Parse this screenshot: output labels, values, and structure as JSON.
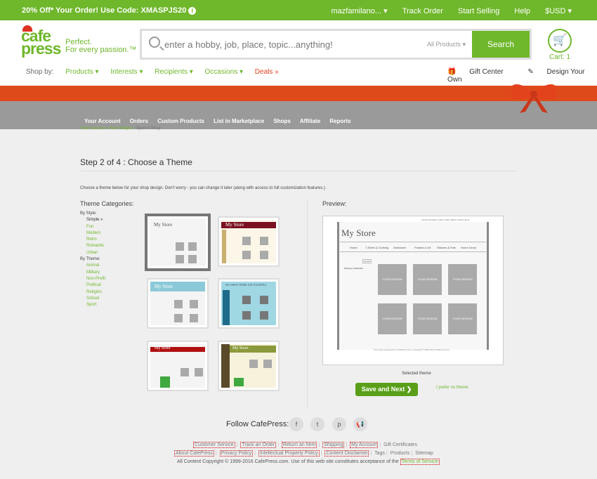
{
  "promo": {
    "text": "20% Off* Your Order! Use Code: XMASPJS20",
    "info_icon": "info-icon",
    "user": "mazfamilano... ▾",
    "track": "Track Order",
    "sell": "Start Selling",
    "help": "Help",
    "currency": "$USD ▾"
  },
  "header": {
    "logo_line1": "cafe",
    "logo_line2": "press",
    "tagline1": "Perfect.",
    "tagline2": "For every passion.™",
    "search_placeholder": "enter a hobby, job, place, topic...anything!",
    "search_category": "All Products ▾",
    "search_button": "Search",
    "cart_label": "Cart: 1"
  },
  "nav": {
    "shop_by": "Shop by:",
    "items": [
      "Products ▾",
      "Interests ▾",
      "Recipients ▾",
      "Occasions ▾"
    ],
    "deals": "Deals »",
    "gift_center": "Gift Center",
    "design": "Design Your Own"
  },
  "subnav": {
    "items": [
      "Your Account",
      "Orders",
      "Custom Products",
      "List in Marketplace",
      "Shops",
      "Affiliate",
      "Reports"
    ]
  },
  "breadcrumb": {
    "a": "Your Account",
    "b": "Your Shops",
    "c": "Open A Shop"
  },
  "step": {
    "title": "Step 2 of 4 : Choose a Theme",
    "description": "Choose a theme below for your shop design. Don't worry - you can change it later (along with access to full customization features.)"
  },
  "categories": {
    "heading": "Theme Categories:",
    "by_style": "By Style:",
    "styles": [
      "Simple »",
      "Fun",
      "Modern",
      "Retro",
      "Romantic",
      "Urban"
    ],
    "by_theme": "By Theme:",
    "themes": [
      "Animal",
      "Military",
      "Non-Profit",
      "Political",
      "Religion",
      "School",
      "Sport"
    ]
  },
  "thumbs": {
    "t1": "My Store",
    "t2": "My Store",
    "t3": "My Store",
    "t4": "MY SHOP TEMPLATE EXAMPLE",
    "t5": "My Store",
    "t6": "My Store"
  },
  "preview": {
    "label": "Preview:",
    "store_title": "My Store",
    "menu": [
      "Home",
      "T-Shirts & Clothing",
      "Drinkware",
      "Posters & Art",
      "Stickers & Flair",
      "Home Decor"
    ],
    "top_links": "Cart & Checkout | Help | Order Status | Shop Home",
    "search_btn": "search",
    "shop_by_collection": "Shop by Collection",
    "your_design": "YOUR DESIGN",
    "footer": "This shop is powered by CafePress.com. Copyright © 1999-2011 CafePress.com.",
    "selected": "Selected theme"
  },
  "actions": {
    "save": "Save and Next ❯",
    "no_theme": "I prefer no theme"
  },
  "footer": {
    "follow": "Follow CafePress:",
    "social_icons": [
      "facebook-icon",
      "twitter-icon",
      "pinterest-icon",
      "megaphone-icon"
    ],
    "row1": [
      "Customer Service",
      "Track an Order",
      "Return an Item",
      "Shipping",
      "My Account"
    ],
    "gift_certificates": "Gift Certificates",
    "row2": [
      "About CafePress",
      "Privacy Policy",
      "Intellectual Property Policy",
      "Content Disclaimer"
    ],
    "tags": "Tags",
    "products": "Products",
    "sitemap": "Sitemap",
    "copyright": "All Content Copyright © 1999-2016 CafePress.com. Use of this web site constitutes acceptance of the",
    "terms": "Terms of Service"
  },
  "colors": {
    "brand_green": "#6fb72b",
    "band_orange": "#df4a1a",
    "deals_red": "#e2431d"
  }
}
